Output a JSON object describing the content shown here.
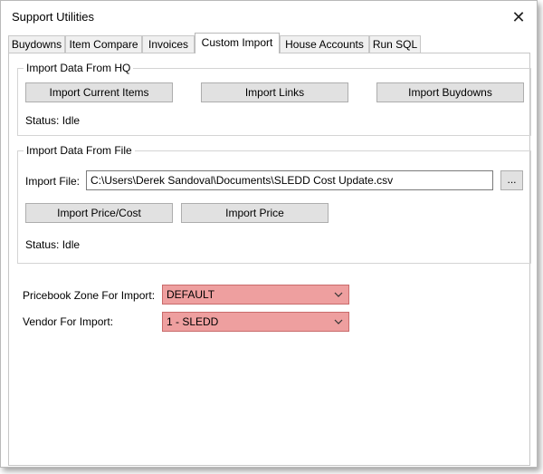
{
  "window": {
    "title": "Support Utilities",
    "close_icon": "close-icon"
  },
  "tabs": [
    {
      "label": "Buydowns"
    },
    {
      "label": "Item Compare"
    },
    {
      "label": "Invoices"
    },
    {
      "label": "Custom Import",
      "active": true
    },
    {
      "label": "House Accounts"
    },
    {
      "label": "Run SQL"
    }
  ],
  "hq_group": {
    "title": "Import Data From HQ",
    "buttons": {
      "import_current_items": "Import Current Items",
      "import_links": "Import Links",
      "import_buydowns": "Import Buydowns"
    },
    "status": "Status: Idle"
  },
  "file_group": {
    "title": "Import Data From File",
    "import_file_label": "Import File:",
    "import_file_value": "C:\\Users\\Derek Sandoval\\Documents\\SLEDD Cost Update.csv",
    "browse_label": "...",
    "buttons": {
      "import_price_cost": "Import Price/Cost",
      "import_price": "Import Price"
    },
    "status": "Status: Idle"
  },
  "pricebook_zone": {
    "label": "Pricebook Zone For Import:",
    "value": "DEFAULT"
  },
  "vendor": {
    "label": "Vendor For Import:",
    "value": "1 - SLEDD"
  },
  "colors": {
    "select_bg": "#ee9f9f",
    "button_bg": "#e1e1e1"
  }
}
